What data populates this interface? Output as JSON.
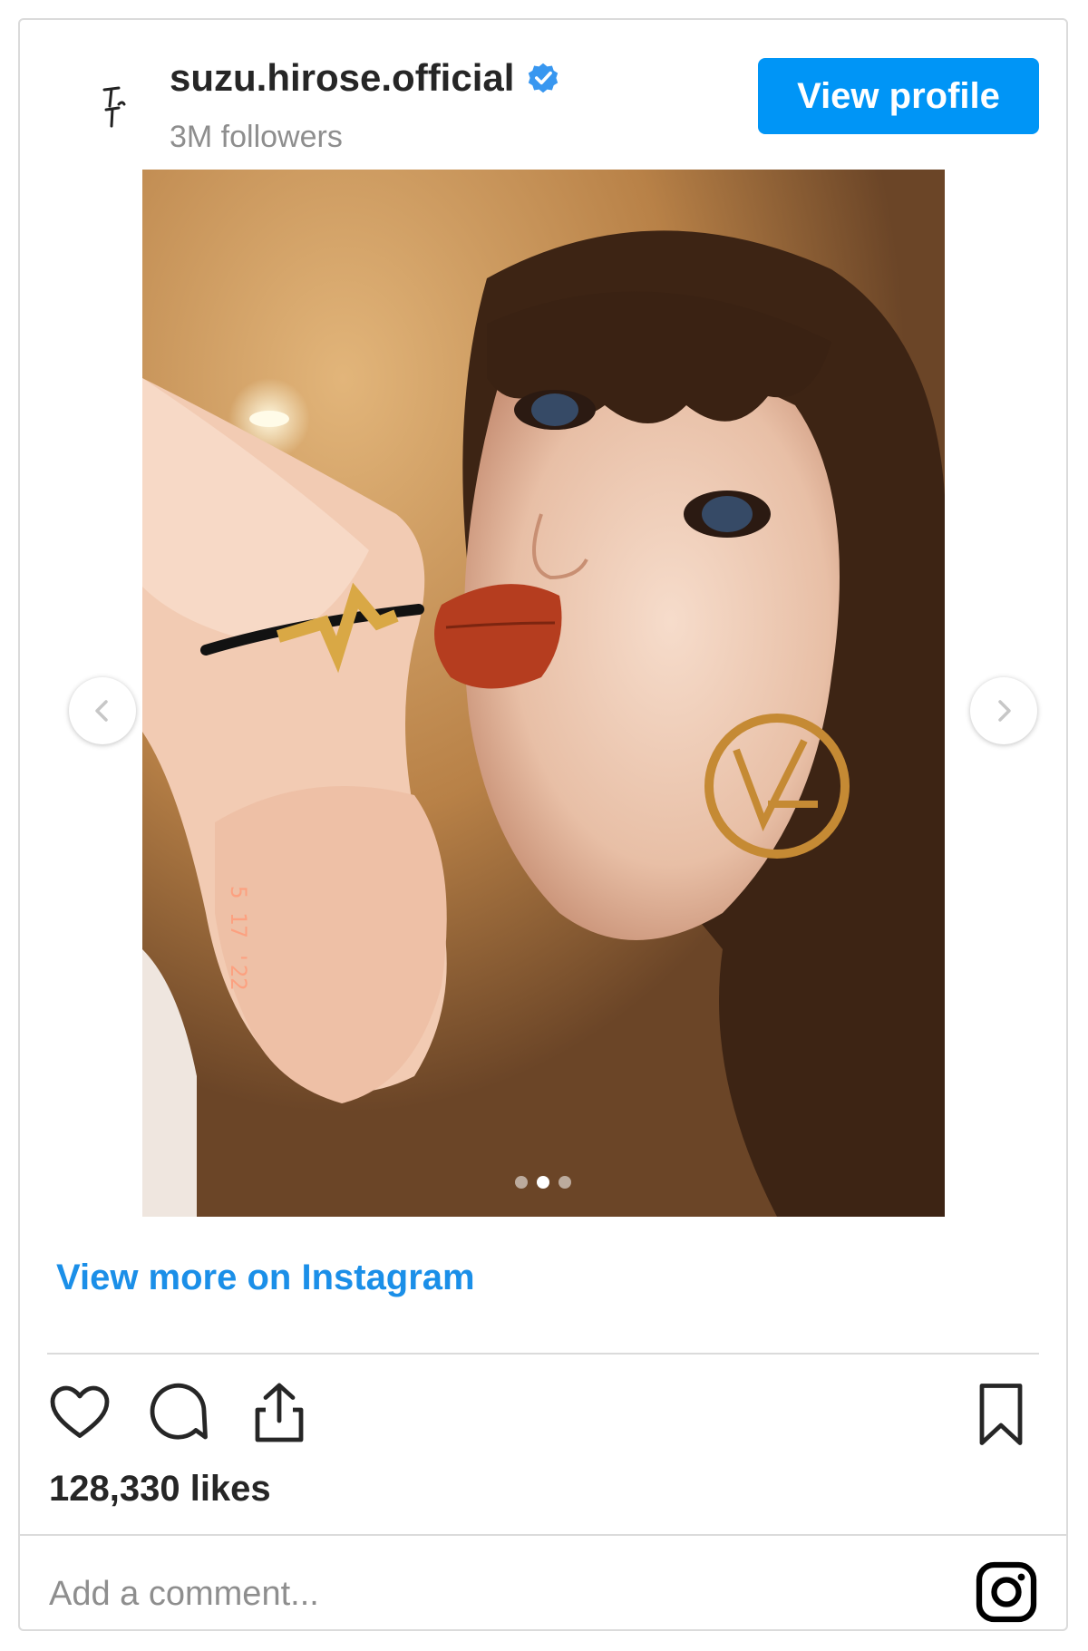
{
  "header": {
    "username": "suzu.hirose.official",
    "followers": "3M followers",
    "view_profile_label": "View profile",
    "verified": true,
    "avatar_icon": "signature-avatar-icon"
  },
  "carousel": {
    "current_index": 2,
    "total": 3,
    "photo_overlay_date": "5 17 '22",
    "prev_icon": "chevron-left-icon",
    "next_icon": "chevron-right-icon"
  },
  "links": {
    "view_more": "View more on Instagram"
  },
  "actions": {
    "like_icon": "heart-icon",
    "comment_icon": "comment-icon",
    "share_icon": "share-icon",
    "save_icon": "bookmark-icon"
  },
  "stats": {
    "likes": "128,330 likes"
  },
  "comment": {
    "placeholder": "Add a comment..."
  },
  "colors": {
    "accent": "#0095f6",
    "link": "#1b8fe8",
    "text": "#262626",
    "muted": "#8e8e8e",
    "border": "#dbdbdb"
  }
}
